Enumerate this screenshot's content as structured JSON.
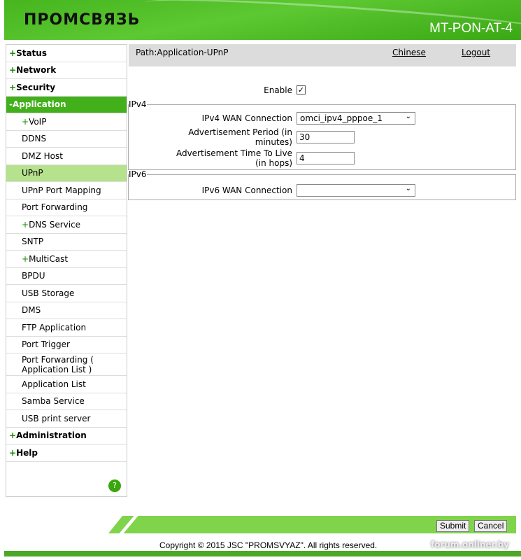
{
  "header": {
    "logo": "ПРОМСВЯЗЬ",
    "model": "MT-PON-AT-4"
  },
  "sidebar": {
    "items": [
      {
        "prefix": "+",
        "label": "Status"
      },
      {
        "prefix": "+",
        "label": "Network"
      },
      {
        "prefix": "+",
        "label": "Security"
      },
      {
        "prefix": "-",
        "label": "Application"
      },
      {
        "prefix": "+",
        "label": "VoIP"
      },
      {
        "prefix": "",
        "label": "DDNS"
      },
      {
        "prefix": "",
        "label": "DMZ Host"
      },
      {
        "prefix": "",
        "label": "UPnP"
      },
      {
        "prefix": "",
        "label": "UPnP Port Mapping"
      },
      {
        "prefix": "",
        "label": "Port Forwarding"
      },
      {
        "prefix": "+",
        "label": "DNS Service"
      },
      {
        "prefix": "",
        "label": "SNTP"
      },
      {
        "prefix": "+",
        "label": "MultiCast"
      },
      {
        "prefix": "",
        "label": "BPDU"
      },
      {
        "prefix": "",
        "label": "USB Storage"
      },
      {
        "prefix": "",
        "label": "DMS"
      },
      {
        "prefix": "",
        "label": "FTP Application"
      },
      {
        "prefix": "",
        "label": "Port Trigger"
      },
      {
        "prefix": "",
        "label": "Port Forwarding ( Application List )"
      },
      {
        "prefix": "",
        "label": "Application List"
      },
      {
        "prefix": "",
        "label": "Samba Service"
      },
      {
        "prefix": "",
        "label": "USB print server"
      },
      {
        "prefix": "+",
        "label": "Administration"
      },
      {
        "prefix": "+",
        "label": "Help"
      }
    ],
    "help_icon": "?"
  },
  "pathbar": {
    "path": "Path:Application-UPnP",
    "chinese": "Chinese",
    "logout": "Logout"
  },
  "form": {
    "enable_label": "Enable",
    "enable_checked": "✓",
    "ipv4_legend": "IPv4",
    "ipv4_wan_label": "IPv4 WAN Connection",
    "ipv4_wan_value": "omci_ipv4_pppoe_1",
    "adv_period_label": "Advertisement Period (in minutes)",
    "adv_period_value": "30",
    "adv_ttl_label": "Advertisement Time To Live (in hops)",
    "adv_ttl_value": "4",
    "ipv6_legend": "IPv6",
    "ipv6_wan_label": "IPv6 WAN Connection",
    "ipv6_wan_value": ""
  },
  "footer": {
    "submit": "Submit",
    "cancel": "Cancel",
    "copyright": "Copyright © 2015 JSC \"PROMSVYAZ\". All rights reserved.",
    "watermark": "forum.onliner.by"
  }
}
